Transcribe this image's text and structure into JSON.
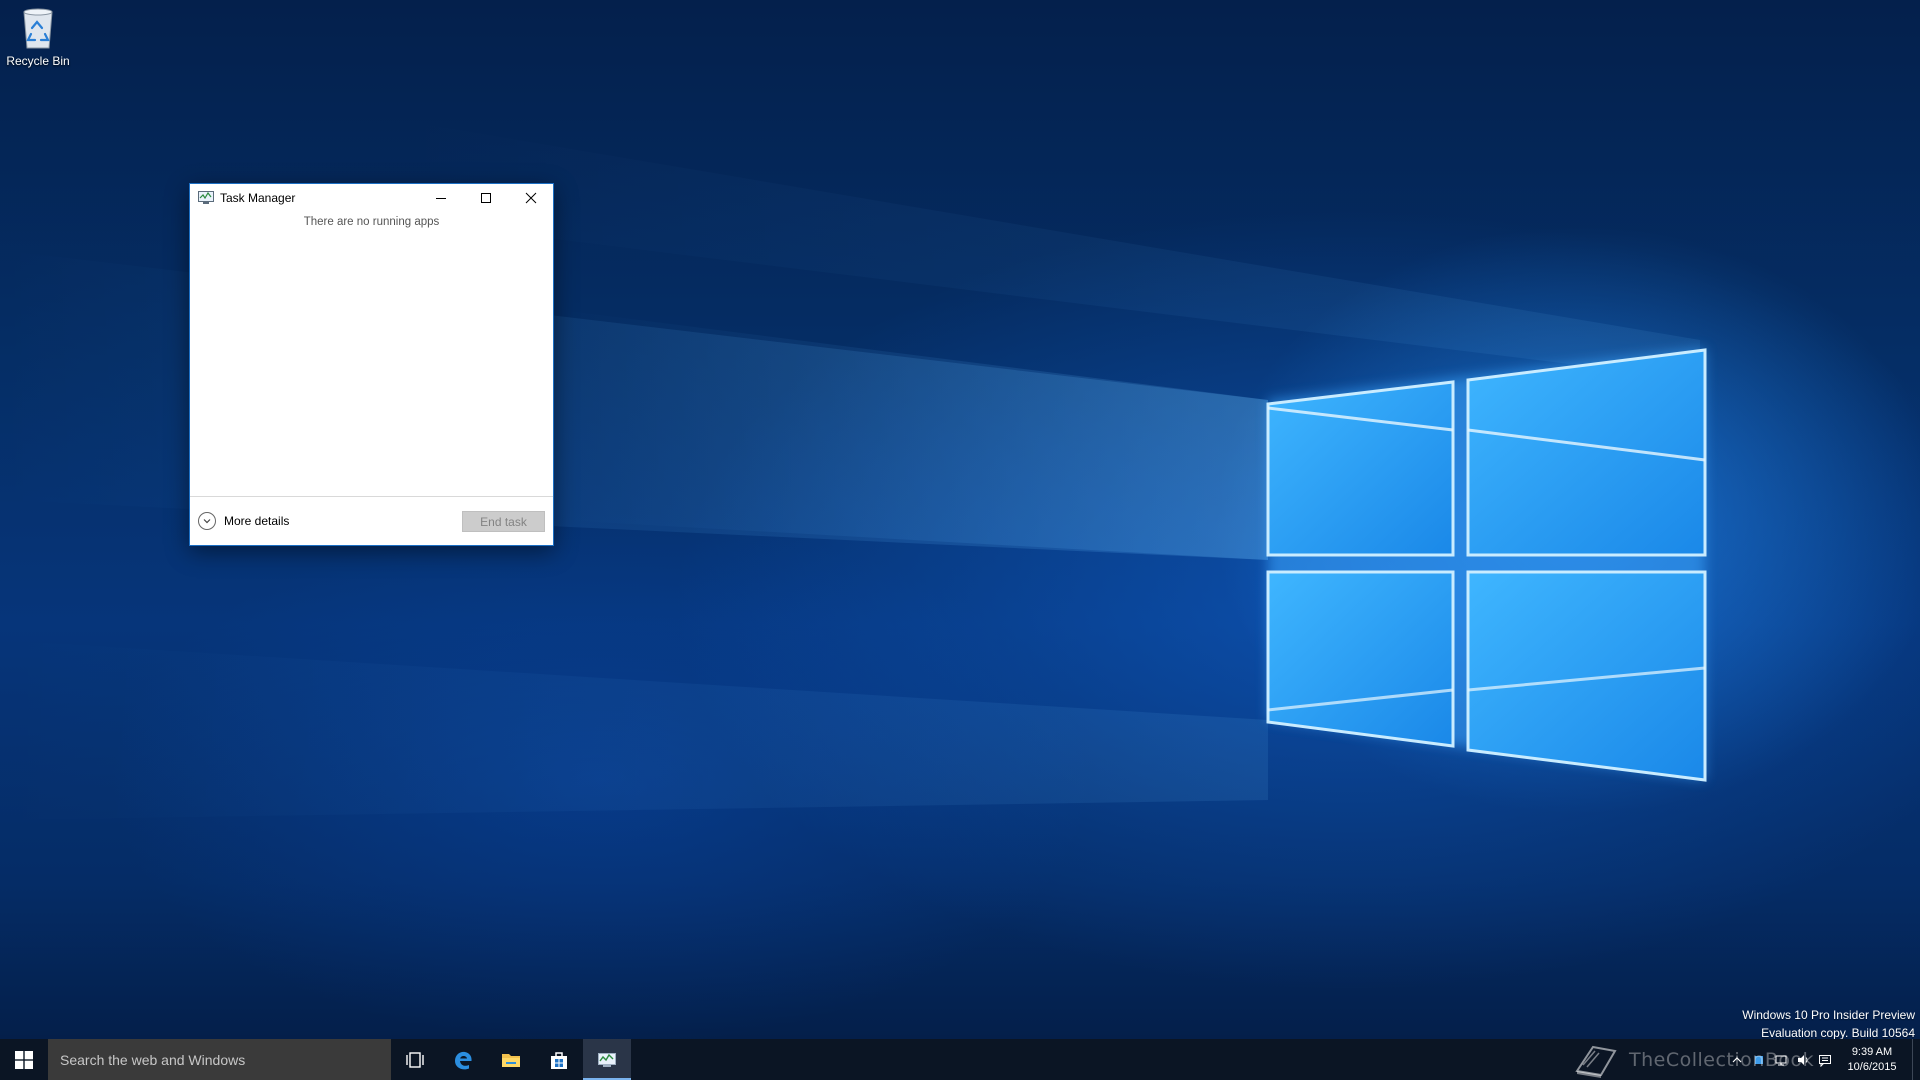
{
  "desktop": {
    "icons": [
      {
        "label": "Recycle Bin",
        "icon": "recycle-bin-icon"
      }
    ],
    "watermark": {
      "line1": "Windows 10 Pro Insider Preview",
      "line2": "Evaluation copy. Build 10564"
    }
  },
  "task_manager": {
    "title": "Task Manager",
    "icon": "task-manager-icon",
    "empty_message": "There are no running apps",
    "more_details_label": "More details",
    "end_task_label": "End task",
    "end_task_enabled": false
  },
  "taskbar": {
    "search_placeholder": "Search the web and Windows",
    "pinned": [
      {
        "name": "task-view-icon"
      },
      {
        "name": "edge-icon"
      },
      {
        "name": "file-explorer-icon"
      },
      {
        "name": "store-icon"
      },
      {
        "name": "task-manager-icon",
        "active": true
      }
    ],
    "tray": {
      "overlay_brand": "TheCollectionBook",
      "time": "9:39 AM",
      "date": "10/6/2015"
    }
  },
  "colors": {
    "accent": "#1b6fc4",
    "taskbar": "#0b1524",
    "search": "#3a3a3a"
  }
}
